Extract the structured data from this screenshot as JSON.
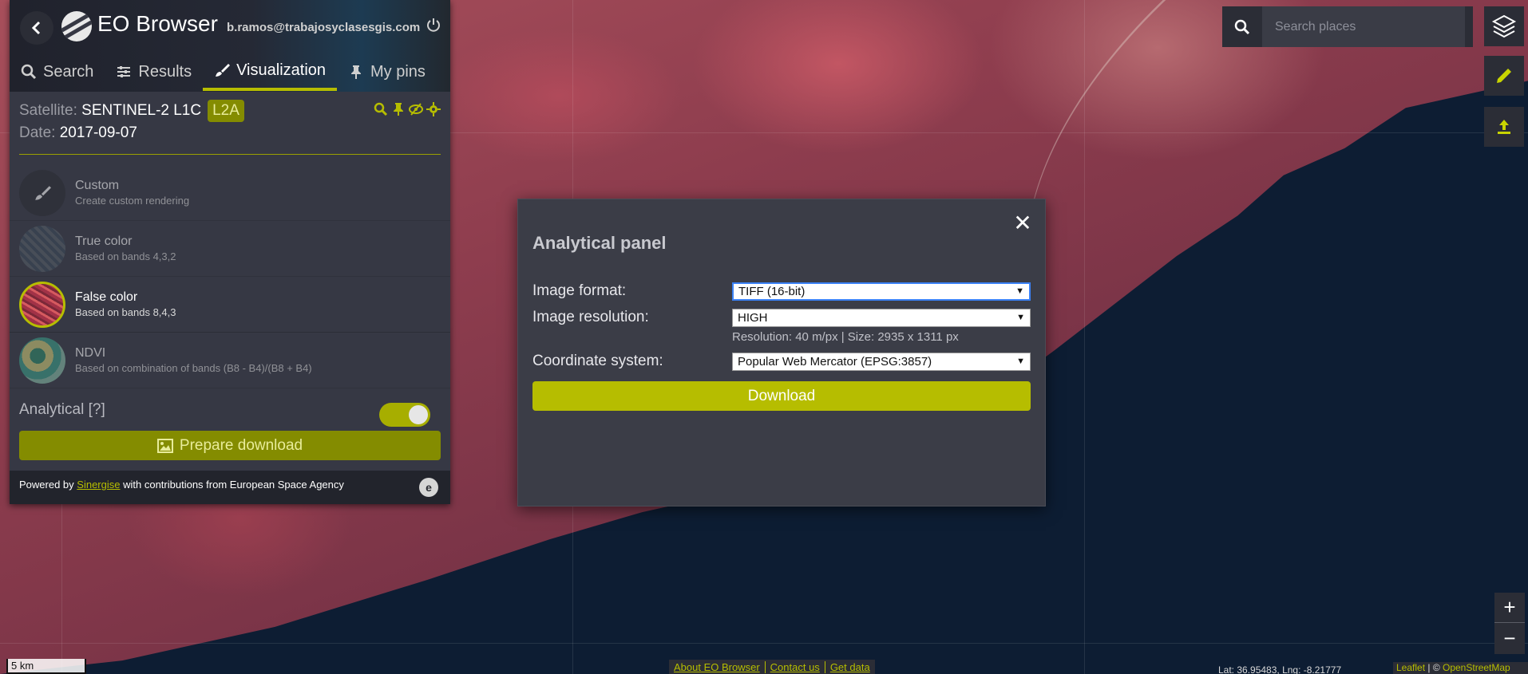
{
  "app": {
    "title": "EO Browser",
    "user_email": "b.ramos@trabajosyclasesgis.com"
  },
  "tabs": [
    {
      "label": "Search",
      "icon": "search-icon"
    },
    {
      "label": "Results",
      "icon": "sliders-icon"
    },
    {
      "label": "Visualization",
      "icon": "brush-icon",
      "active": true
    },
    {
      "label": "My pins",
      "icon": "pin-icon"
    }
  ],
  "info": {
    "satellite_label": "Satellite:",
    "satellite_value": "SENTINEL-2 L1C",
    "badge": "L2A",
    "date_label": "Date:",
    "date_value": "2017-09-07"
  },
  "layers": [
    {
      "name": "Custom",
      "desc": "Create custom rendering"
    },
    {
      "name": "True color",
      "desc": "Based on bands 4,3,2"
    },
    {
      "name": "False color",
      "desc": "Based on bands 8,4,3",
      "selected": true
    },
    {
      "name": "NDVI",
      "desc": "Based on combination of bands (B8 - B4)/(B8 + B4)"
    }
  ],
  "analytical": {
    "label": "Analytical [?]",
    "enabled": true
  },
  "prepare_download_label": "Prepare download",
  "footer": {
    "powered_prefix": "Powered by",
    "powered_link": "Sinergise",
    "powered_suffix": "with contributions from European Space Agency",
    "esa_logo": "e"
  },
  "search": {
    "placeholder": "Search places"
  },
  "modal": {
    "title": "Analytical panel",
    "close": "✕",
    "image_format_label": "Image format:",
    "image_format_value": "TIFF (16-bit)",
    "image_resolution_label": "Image resolution:",
    "image_resolution_value": "HIGH",
    "resolution_note": "Resolution: 40 m/px | Size: 2935 x 1311 px",
    "coordinate_label": "Coordinate system:",
    "coordinate_value": "Popular Web Mercator (EPSG:3857)",
    "download_label": "Download"
  },
  "zoom": {
    "in": "+",
    "out": "−"
  },
  "map": {
    "scale_label": "5 km",
    "footer_links": [
      "About EO Browser",
      "Contact us",
      "Get data"
    ],
    "coords": "Lat: 36.95483, Lng: -8.21777",
    "attribution_link1": "Leaflet",
    "attribution_sep": " | © ",
    "attribution_link2": "OpenStreetMap"
  },
  "colors": {
    "accent": "#b6bd00",
    "accent_dark": "#848c00",
    "panel_bg": "#363844"
  }
}
